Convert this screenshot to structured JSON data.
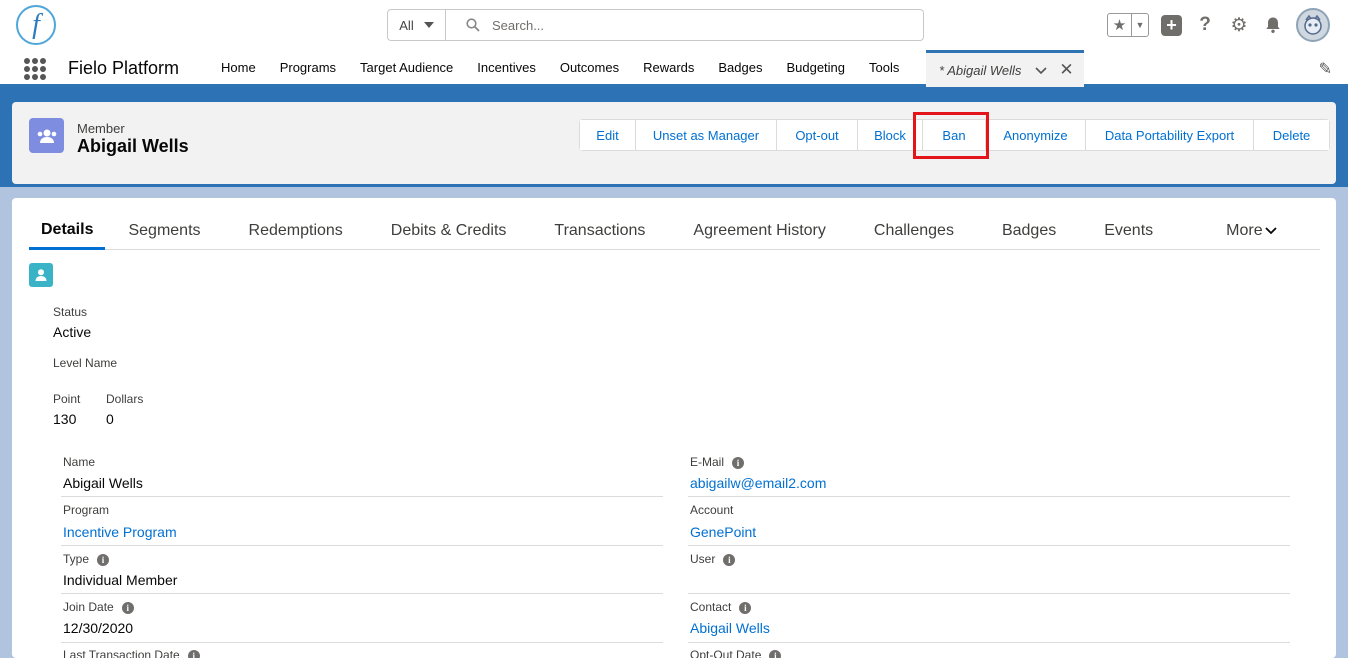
{
  "header": {
    "logo_letter": "f",
    "search_scope": "All",
    "search_placeholder": "Search...",
    "icons": [
      "favorites-star-icon",
      "add-icon",
      "help-icon",
      "setup-gear-icon",
      "notification-bell-icon",
      "user-avatar"
    ]
  },
  "nav": {
    "app_name": "Fielo Platform",
    "items": [
      "Home",
      "Programs",
      "Target Audience",
      "Incentives",
      "Outcomes",
      "Rewards",
      "Badges",
      "Budgeting",
      "Tools"
    ],
    "active_tab": "* Abigail Wells"
  },
  "record": {
    "type": "Member",
    "name": "Abigail Wells",
    "actions": [
      "Edit",
      "Unset as Manager",
      "Opt-out",
      "Block",
      "Ban",
      "Anonymize",
      "Data Portability Export",
      "Delete"
    ],
    "highlighted_action": "Ban"
  },
  "tabs": [
    "Details",
    "Segments",
    "Redemptions",
    "Debits & Credits",
    "Transactions",
    "Agreement History",
    "Challenges",
    "Badges",
    "Events",
    "More"
  ],
  "summary": {
    "status_label": "Status",
    "status_value": "Active",
    "level_label": "Level Name",
    "point_label": "Point",
    "point_value": "130",
    "dollars_label": "Dollars",
    "dollars_value": "0"
  },
  "fields": {
    "name_label": "Name",
    "name_value": "Abigail Wells",
    "email_label": "E-Mail",
    "email_value": "abigailw@email2.com",
    "program_label": "Program",
    "program_value": "Incentive Program",
    "account_label": "Account",
    "account_value": "GenePoint",
    "type_label": "Type",
    "type_value": "Individual Member",
    "user_label": "User",
    "join_label": "Join Date",
    "join_value": "12/30/2020",
    "contact_label": "Contact",
    "contact_value": "Abigail Wells",
    "last_tx_label": "Last Transaction Date",
    "optout_label": "Opt-Out Date"
  },
  "colors": {
    "brand_blue": "#2e74b5",
    "link": "#0070d2",
    "highlight_red": "#e3151b",
    "member_icon": "#7f8de1",
    "contact_icon": "#3bb3c7"
  }
}
